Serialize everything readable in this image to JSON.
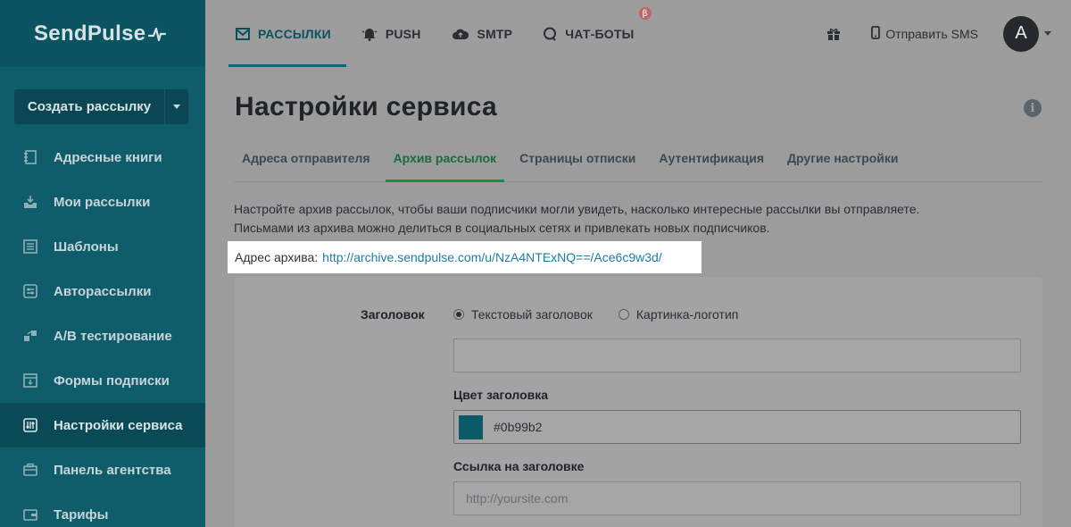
{
  "brand": {
    "name": "SendPulse"
  },
  "sidebar": {
    "create_label": "Создать рассылку",
    "items": [
      {
        "label": "Адресные книги",
        "icon": "address-book-icon"
      },
      {
        "label": "Мои рассылки",
        "icon": "mailing-icon"
      },
      {
        "label": "Шаблоны",
        "icon": "template-icon"
      },
      {
        "label": "Авторассылки",
        "icon": "automation-icon"
      },
      {
        "label": "A/B тестирование",
        "icon": "ab-test-icon"
      },
      {
        "label": "Формы подписки",
        "icon": "form-icon"
      },
      {
        "label": "Настройки сервиса",
        "icon": "settings-icon",
        "active": true
      },
      {
        "label": "Панель агентства",
        "icon": "briefcase-icon"
      },
      {
        "label": "Тарифы",
        "icon": "wallet-icon"
      }
    ]
  },
  "topnav": {
    "items": [
      {
        "label": "РАССЫЛКИ",
        "icon": "mail-icon",
        "active": true
      },
      {
        "label": "PUSH",
        "icon": "bell-icon"
      },
      {
        "label": "SMTP",
        "icon": "cloud-icon"
      },
      {
        "label": "ЧАТ-БОТЫ",
        "icon": "chat-icon",
        "badge": "β"
      }
    ],
    "sms_label": "Отправить SMS",
    "avatar_letter": "A"
  },
  "page": {
    "title": "Настройки сервиса",
    "tabs": [
      {
        "label": "Адреса отправителя"
      },
      {
        "label": "Архив рассылок",
        "active": true
      },
      {
        "label": "Страницы отписки"
      },
      {
        "label": "Аутентификация"
      },
      {
        "label": "Другие настройки"
      }
    ],
    "description_line1": "Настройте архив рассылок, чтобы ваши подписчики могли увидеть, насколько интересные рассылки вы отправляете.",
    "description_line2": "Письмами из архива можно делиться в социальных сетях и привлекать новых подписчиков.",
    "archive_label": "Адрес архива:",
    "archive_url": "http://archive.sendpulse.com/u/NzA4NTExNQ==/Ace6c9w3d/"
  },
  "form": {
    "header_label": "Заголовок",
    "radio_text": "Текстовый заголовок",
    "radio_logo": "Картинка-логотип",
    "header_value": "",
    "color_label": "Цвет заголовка",
    "color_value": "#0b99b2",
    "link_label": "Ссылка на заголовке",
    "link_placeholder": "http://yoursite.com"
  },
  "colors": {
    "sidebar_bg": "#0f5d6b",
    "accent": "#0b99b2",
    "active_tab": "#1e8a4a",
    "link": "#1b7fa0"
  }
}
